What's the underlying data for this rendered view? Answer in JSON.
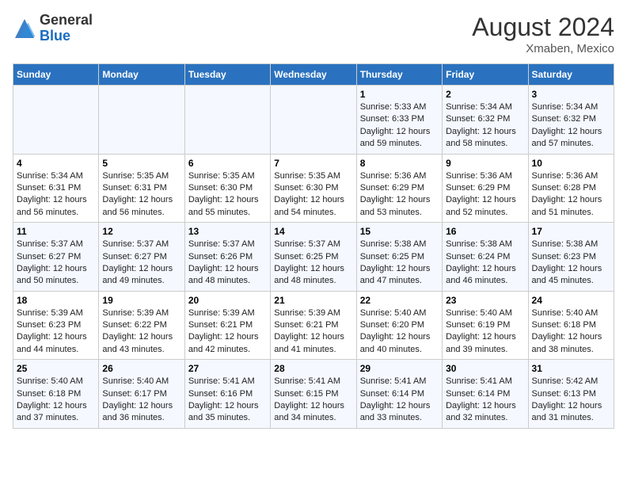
{
  "header": {
    "logo_line1": "General",
    "logo_line2": "Blue",
    "month_year": "August 2024",
    "location": "Xmaben, Mexico"
  },
  "weekdays": [
    "Sunday",
    "Monday",
    "Tuesday",
    "Wednesday",
    "Thursday",
    "Friday",
    "Saturday"
  ],
  "weeks": [
    [
      {
        "day": "",
        "info": ""
      },
      {
        "day": "",
        "info": ""
      },
      {
        "day": "",
        "info": ""
      },
      {
        "day": "",
        "info": ""
      },
      {
        "day": "1",
        "info": "Sunrise: 5:33 AM\nSunset: 6:33 PM\nDaylight: 12 hours\nand 59 minutes."
      },
      {
        "day": "2",
        "info": "Sunrise: 5:34 AM\nSunset: 6:32 PM\nDaylight: 12 hours\nand 58 minutes."
      },
      {
        "day": "3",
        "info": "Sunrise: 5:34 AM\nSunset: 6:32 PM\nDaylight: 12 hours\nand 57 minutes."
      }
    ],
    [
      {
        "day": "4",
        "info": "Sunrise: 5:34 AM\nSunset: 6:31 PM\nDaylight: 12 hours\nand 56 minutes."
      },
      {
        "day": "5",
        "info": "Sunrise: 5:35 AM\nSunset: 6:31 PM\nDaylight: 12 hours\nand 56 minutes."
      },
      {
        "day": "6",
        "info": "Sunrise: 5:35 AM\nSunset: 6:30 PM\nDaylight: 12 hours\nand 55 minutes."
      },
      {
        "day": "7",
        "info": "Sunrise: 5:35 AM\nSunset: 6:30 PM\nDaylight: 12 hours\nand 54 minutes."
      },
      {
        "day": "8",
        "info": "Sunrise: 5:36 AM\nSunset: 6:29 PM\nDaylight: 12 hours\nand 53 minutes."
      },
      {
        "day": "9",
        "info": "Sunrise: 5:36 AM\nSunset: 6:29 PM\nDaylight: 12 hours\nand 52 minutes."
      },
      {
        "day": "10",
        "info": "Sunrise: 5:36 AM\nSunset: 6:28 PM\nDaylight: 12 hours\nand 51 minutes."
      }
    ],
    [
      {
        "day": "11",
        "info": "Sunrise: 5:37 AM\nSunset: 6:27 PM\nDaylight: 12 hours\nand 50 minutes."
      },
      {
        "day": "12",
        "info": "Sunrise: 5:37 AM\nSunset: 6:27 PM\nDaylight: 12 hours\nand 49 minutes."
      },
      {
        "day": "13",
        "info": "Sunrise: 5:37 AM\nSunset: 6:26 PM\nDaylight: 12 hours\nand 48 minutes."
      },
      {
        "day": "14",
        "info": "Sunrise: 5:37 AM\nSunset: 6:25 PM\nDaylight: 12 hours\nand 48 minutes."
      },
      {
        "day": "15",
        "info": "Sunrise: 5:38 AM\nSunset: 6:25 PM\nDaylight: 12 hours\nand 47 minutes."
      },
      {
        "day": "16",
        "info": "Sunrise: 5:38 AM\nSunset: 6:24 PM\nDaylight: 12 hours\nand 46 minutes."
      },
      {
        "day": "17",
        "info": "Sunrise: 5:38 AM\nSunset: 6:23 PM\nDaylight: 12 hours\nand 45 minutes."
      }
    ],
    [
      {
        "day": "18",
        "info": "Sunrise: 5:39 AM\nSunset: 6:23 PM\nDaylight: 12 hours\nand 44 minutes."
      },
      {
        "day": "19",
        "info": "Sunrise: 5:39 AM\nSunset: 6:22 PM\nDaylight: 12 hours\nand 43 minutes."
      },
      {
        "day": "20",
        "info": "Sunrise: 5:39 AM\nSunset: 6:21 PM\nDaylight: 12 hours\nand 42 minutes."
      },
      {
        "day": "21",
        "info": "Sunrise: 5:39 AM\nSunset: 6:21 PM\nDaylight: 12 hours\nand 41 minutes."
      },
      {
        "day": "22",
        "info": "Sunrise: 5:40 AM\nSunset: 6:20 PM\nDaylight: 12 hours\nand 40 minutes."
      },
      {
        "day": "23",
        "info": "Sunrise: 5:40 AM\nSunset: 6:19 PM\nDaylight: 12 hours\nand 39 minutes."
      },
      {
        "day": "24",
        "info": "Sunrise: 5:40 AM\nSunset: 6:18 PM\nDaylight: 12 hours\nand 38 minutes."
      }
    ],
    [
      {
        "day": "25",
        "info": "Sunrise: 5:40 AM\nSunset: 6:18 PM\nDaylight: 12 hours\nand 37 minutes."
      },
      {
        "day": "26",
        "info": "Sunrise: 5:40 AM\nSunset: 6:17 PM\nDaylight: 12 hours\nand 36 minutes."
      },
      {
        "day": "27",
        "info": "Sunrise: 5:41 AM\nSunset: 6:16 PM\nDaylight: 12 hours\nand 35 minutes."
      },
      {
        "day": "28",
        "info": "Sunrise: 5:41 AM\nSunset: 6:15 PM\nDaylight: 12 hours\nand 34 minutes."
      },
      {
        "day": "29",
        "info": "Sunrise: 5:41 AM\nSunset: 6:14 PM\nDaylight: 12 hours\nand 33 minutes."
      },
      {
        "day": "30",
        "info": "Sunrise: 5:41 AM\nSunset: 6:14 PM\nDaylight: 12 hours\nand 32 minutes."
      },
      {
        "day": "31",
        "info": "Sunrise: 5:42 AM\nSunset: 6:13 PM\nDaylight: 12 hours\nand 31 minutes."
      }
    ]
  ]
}
